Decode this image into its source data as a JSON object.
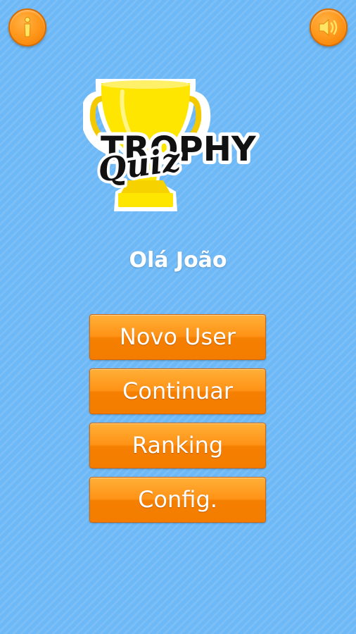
{
  "header": {
    "info_icon": "info-icon",
    "sound_icon": "speaker-icon"
  },
  "logo": {
    "title": "TROPHY",
    "subtitle": "Quiz"
  },
  "greeting": "Olá João",
  "menu": {
    "new_user": "Novo User",
    "continue": "Continuar",
    "ranking": "Ranking",
    "settings": "Config."
  },
  "colors": {
    "background": "#6db8f6",
    "button": "#ff9216",
    "trophy": "#ffe600"
  }
}
